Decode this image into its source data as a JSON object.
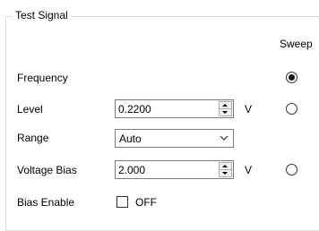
{
  "group": {
    "title": "Test Signal",
    "sweep_header": "Sweep"
  },
  "rows": {
    "frequency": {
      "label": "Frequency",
      "sweep_selected": true
    },
    "level": {
      "label": "Level",
      "value": "0.2200",
      "unit": "V",
      "sweep_selected": false
    },
    "range": {
      "label": "Range",
      "value": "Auto"
    },
    "voltage_bias": {
      "label": "Voltage Bias",
      "value": "2.000",
      "unit": "V",
      "sweep_selected": false
    },
    "bias_enable": {
      "label": "Bias Enable",
      "checked": false,
      "state_text": "OFF"
    }
  },
  "icons": {
    "spin_up": "caret-up-icon",
    "spin_down": "caret-down-icon",
    "dropdown": "chevron-down-icon"
  }
}
